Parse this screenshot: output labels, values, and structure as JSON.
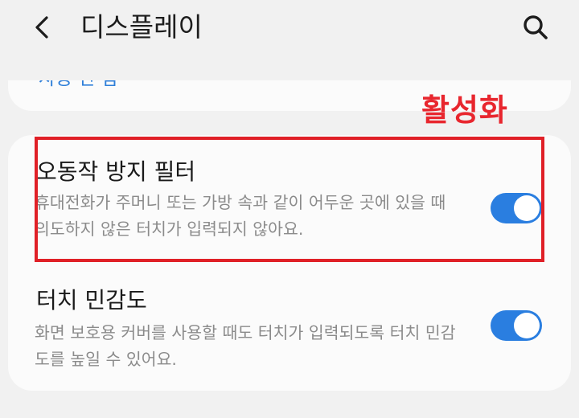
{
  "header": {
    "title": "디스플레이",
    "back_icon": "chevron-left-icon",
    "search_icon": "search-icon"
  },
  "annotation": {
    "label": "활성화",
    "color": "#e8262e"
  },
  "settings": [
    {
      "title": "오동작 방지 필터",
      "description": "휴대전화가 주머니 또는 가방 속과 같이 어두운 곳에 있을 때 의도하지 않은 터치가 입력되지 않아요.",
      "enabled": true
    },
    {
      "title": "터치 민감도",
      "description": "화면 보호용 커버를 사용할 때도 터치가 입력되도록 터치 민감도를 높일 수 있어요.",
      "enabled": true
    }
  ],
  "colors": {
    "background": "#f1f1f1",
    "card": "#fbfbfb",
    "toggle_on": "#2a7ee0",
    "highlight": "#e02027"
  }
}
